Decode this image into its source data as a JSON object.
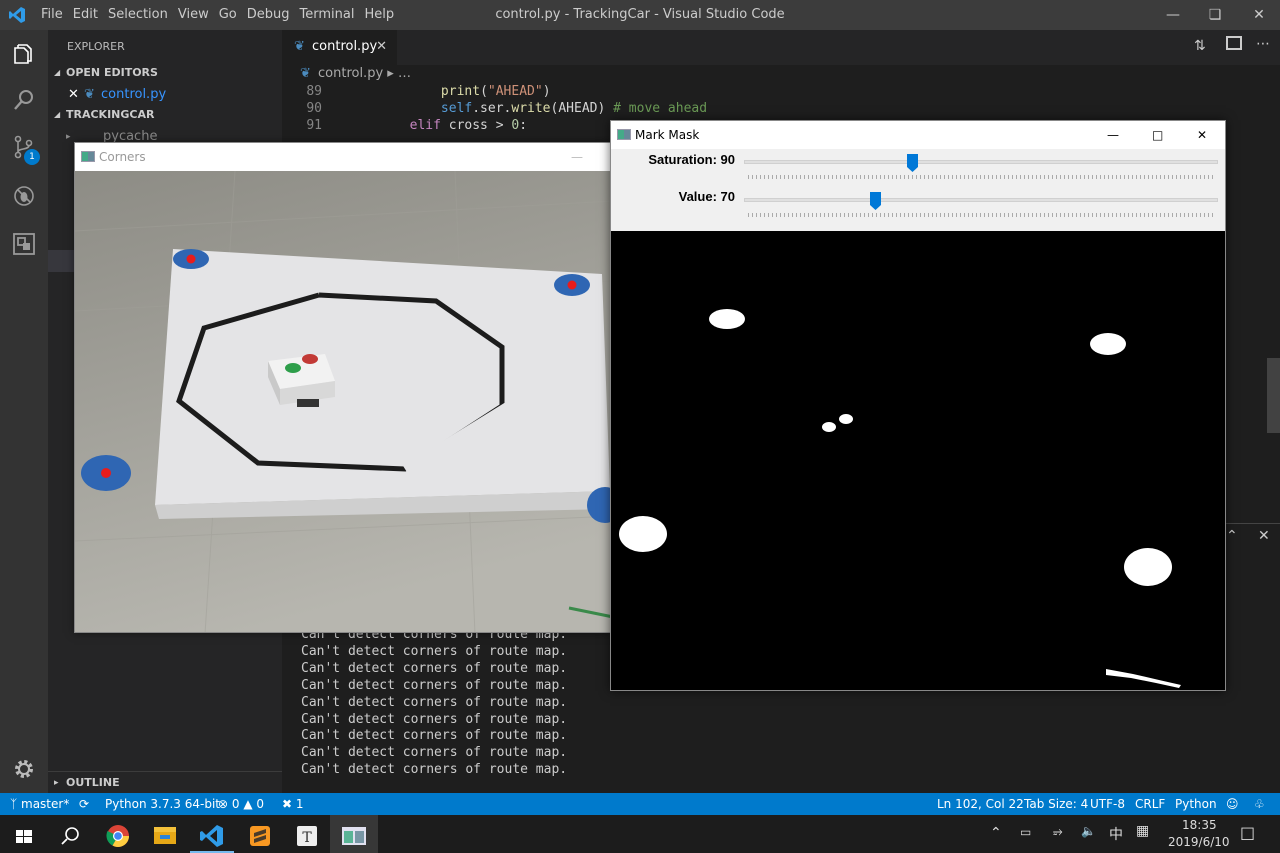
{
  "window": {
    "title": "control.py - TrackingCar - Visual Studio Code",
    "menu": [
      "File",
      "Edit",
      "Selection",
      "View",
      "Go",
      "Debug",
      "Terminal",
      "Help"
    ]
  },
  "sidebar": {
    "title": "EXPLORER",
    "open_editors": "OPEN EDITORS",
    "open_file": "control.py",
    "project": "TRACKINGCAR",
    "items": [
      "__pycache__"
    ],
    "outline": "OUTLINE"
  },
  "activity": {
    "scm_badge": "1"
  },
  "editor": {
    "tab": "control.py",
    "breadcrumb_file": "control.py",
    "breadcrumb_more": "…",
    "lines": [
      {
        "num": "89",
        "text": "            print(\"AHEAD\")"
      },
      {
        "num": "90",
        "text": "            self.ser.write(AHEAD) # move ahead"
      },
      {
        "num": "91",
        "text": "        elif cross > 0:"
      }
    ]
  },
  "terminal": {
    "lines": [
      "Can't detect corners of route map.",
      "Can't detect corners of route map.",
      "Can't detect corners of route map.",
      "Can't detect corners of route map.",
      "Can't detect corners of route map.",
      "Can't detect corners of route map.",
      "Can't detect corners of route map.",
      "Can't detect corners of route map.",
      "Can't detect corners of route map."
    ]
  },
  "status": {
    "branch": "master*",
    "python": "Python 3.7.3 64-bit",
    "errors": "0",
    "warnings": "0",
    "tools": "1",
    "position": "Ln 102, Col 22",
    "tabsize": "Tab Size: 4",
    "encoding": "UTF-8",
    "eol": "CRLF",
    "language": "Python"
  },
  "corners_window": {
    "title": "Corners"
  },
  "mask_window": {
    "title": "Mark Mask",
    "sliders": [
      {
        "label": "Saturation: 90",
        "value": 90,
        "max": 255
      },
      {
        "label": "Value: 70",
        "value": 70,
        "max": 255
      }
    ]
  },
  "taskbar": {
    "ime": "中",
    "time": "18:35",
    "date": "2019/6/10"
  },
  "colors": {
    "accent": "#007acc",
    "slider_thumb": "#0078d7"
  }
}
